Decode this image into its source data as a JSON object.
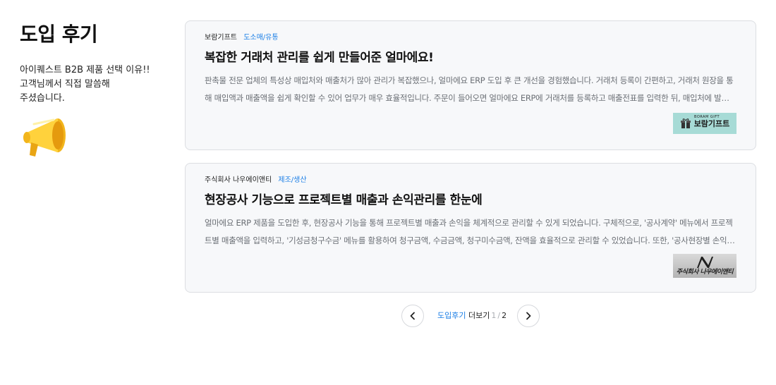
{
  "section": {
    "title": "도입 후기",
    "intro_lines": [
      "아이퀘스트 B2B 제품 선택 이유!!",
      "고객님께서 직접 말씀해",
      "주셨습니다."
    ]
  },
  "icons": {
    "megaphone": "megaphone-icon",
    "prev": "chevron-left-icon",
    "next": "chevron-right-icon"
  },
  "colors": {
    "accent": "#1a7ee6",
    "card_bg": "#f7f8fa",
    "card_border": "#dcdee2",
    "body_text": "#6b6f75"
  },
  "reviews": [
    {
      "company": "보람기프트",
      "category": "도소매/유통",
      "title": "복잡한 거래처 관리를 쉽게 만들어준 얼마에요!",
      "body": "판촉물 전문 업체의 특성상 매입처와 매출처가 많아 관리가 복잡했으나, 얼마에요 ERP 도입 후 큰 개선을 경험했습니다.    거래처 등록이 간편하고, 거래처 원장을 통해 매입액과 매출액을 쉽게 확인할 수 있어 업무가 매우 효율적입니다. 주문이 들어오면 얼마에요 ERP에 거래처를 등록하고 매출전표를 입력한 뒤, 매입처에 발주하고 매입전표를 입력합니다.",
      "logo": {
        "small": "BORAM GIFT",
        "name": "보람기프트"
      }
    },
    {
      "company": "주식회사 나우에이앤티",
      "category": "제조/생산",
      "title": "현장공사 기능으로 프로젝트별 매출과 손익관리를 한눈에",
      "body": "얼마에요 ERP 제품을 도입한 후, 현장공사 기능을 통해 프로젝트별 매출과 손익을 체계적으로 관리할 수 있게 되었습니다.    구체적으로, '공사계약' 메뉴에서 프로젝트별 매출액을 입력하고,  '기성금청구수금' 메뉴를 활용하여 청구금액, 수금금액, 청구미수금액, 잔액을 효율적으로 관리할 수 있었습니다.  또한, '공사현장별 손익' 메뉴를 통해 현장별 손익을 한눈에 확인할 수 있습니다.",
      "logo": {
        "name": "주식회사 나우에이앤티"
      }
    }
  ],
  "pager": {
    "label_blue": "도입후기",
    "label_more": "더보기",
    "current": "1",
    "separator": "/",
    "total": "2"
  }
}
